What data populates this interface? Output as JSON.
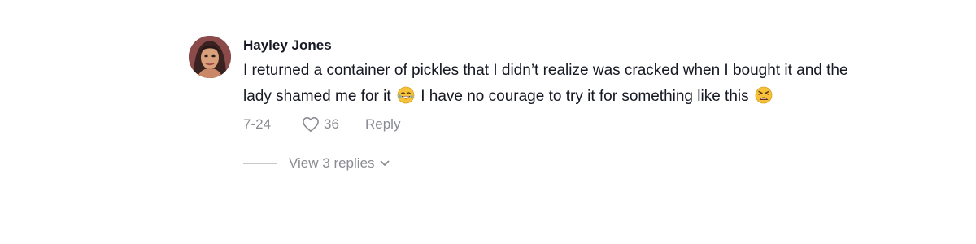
{
  "comment": {
    "author": "Hayley Jones",
    "text_parts": [
      "I returned a container of pickles that I didn’t realize was cracked when I bought it and the lady shamed me for it",
      "I have no courage to try it for something like this"
    ],
    "emojis": [
      "face-with-tears-of-joy-icon",
      "tired-face-icon"
    ],
    "date": "7-24",
    "likes": "36",
    "reply_label": "Reply",
    "view_replies_label": "View 3 replies"
  },
  "colors": {
    "text": "#161823",
    "muted": "#8a8b91",
    "emoji_yellow": "#f7c23a"
  }
}
